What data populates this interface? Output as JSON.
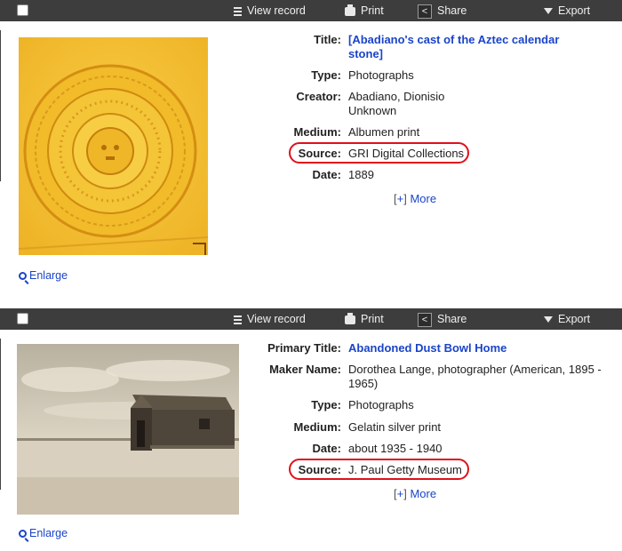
{
  "toolbar": {
    "view_record": "View record",
    "print": "Print",
    "share": "Share",
    "export": "Export"
  },
  "records": [
    {
      "title_label": "Title:",
      "title": "[Abadiano's cast of the Aztec calendar stone]",
      "type_label": "Type:",
      "type": "Photographs",
      "creator_label": "Creator:",
      "creator_1": "Abadiano, Dionisio",
      "creator_2": "Unknown",
      "medium_label": "Medium:",
      "medium": "Albumen print",
      "source_label": "Source:",
      "source": "GRI Digital Collections",
      "date_label": "Date:",
      "date": "1889",
      "more_open": "[",
      "more_plus": "+",
      "more_close": "]",
      "more": "More",
      "enlarge": "Enlarge",
      "thumbnail_colors": {
        "base": "#f3c02a",
        "dark": "#d98f10",
        "light": "#fde27a"
      }
    },
    {
      "title_label": "Primary Title:",
      "title": "Abandoned Dust Bowl Home",
      "maker_label": "Maker Name:",
      "maker": "Dorothea Lange, photographer (American, 1895 - 1965)",
      "type_label": "Type:",
      "type": "Photographs",
      "medium_label": "Medium:",
      "medium": "Gelatin silver print",
      "date_label": "Date:",
      "date": "about 1935 - 1940",
      "source_label": "Source:",
      "source": "J. Paul Getty Museum",
      "more_open": "[",
      "more_plus": "+",
      "more_close": "]",
      "more": "More",
      "enlarge": "Enlarge",
      "thumbnail_colors": {
        "sky": "#cfc6b3",
        "ground": "#d8cfbe",
        "house": "#4a4137"
      }
    }
  ],
  "colors": {
    "toolbar_bg": "#3d3d3d",
    "link": "#1a44c8",
    "highlight_oval": "#e0101a"
  },
  "icons": [
    "checkbox-icon",
    "list-icon",
    "printer-icon",
    "share-icon",
    "caret-down-icon",
    "magnifier-icon"
  ]
}
